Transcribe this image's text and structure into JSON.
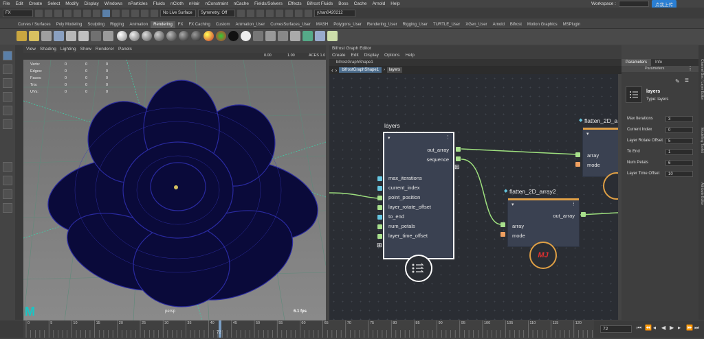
{
  "menubar": {
    "items": [
      "File",
      "Edit",
      "Create",
      "Select",
      "Modify",
      "Display",
      "Windows",
      "nParticles",
      "Fluids",
      "nCloth",
      "nHair",
      "nConstraint",
      "nCache",
      "Fields/Solvers",
      "Effects",
      "Bifrost Fluids",
      "Boss",
      "Cache",
      "Arnold",
      "Help"
    ],
    "workspace_label": "Workspace :",
    "upload_label": "点我上传"
  },
  "statusline": {
    "mode": "FX",
    "live_surface": "No Live Surface",
    "symmetry": "Symmetry: Off",
    "user": "y.han0420212"
  },
  "shelf": {
    "tabs": [
      "Curves / Surfaces",
      "Poly Modeling",
      "Sculpting",
      "Rigging",
      "Animation",
      "Rendering",
      "FX",
      "FX Caching",
      "Custom",
      "Animation_User",
      "CurvesSurfaces_User",
      "MASH",
      "Polygons_User",
      "Rendering_User",
      "Rigging_User",
      "TURTLE_User",
      "XGen_User",
      "Arnold",
      "Bifrost",
      "Motion Graphics",
      "MSPlugin"
    ],
    "active_tab": "Rendering"
  },
  "viewport": {
    "menu": [
      "View",
      "Shading",
      "Lighting",
      "Show",
      "Renderer",
      "Panels"
    ],
    "toolbar_values": {
      "val1": "0.00",
      "val2": "1.00",
      "colorspace": "ACES 1.0"
    },
    "hud": {
      "rows": [
        {
          "label": "Verts:",
          "a": "0",
          "b": "0",
          "c": "0"
        },
        {
          "label": "Edges:",
          "a": "0",
          "b": "0",
          "c": "0"
        },
        {
          "label": "Faces:",
          "a": "0",
          "b": "0",
          "c": "0"
        },
        {
          "label": "Tris:",
          "a": "0",
          "b": "0",
          "c": "0"
        },
        {
          "label": "UVs:",
          "a": "0",
          "b": "0",
          "c": "0"
        }
      ]
    },
    "camera": "persp",
    "fps": "6.1 fps"
  },
  "graph_editor": {
    "title": "Bifrost Graph Editor",
    "menu": [
      "Create",
      "Edit",
      "Display",
      "Options",
      "Help"
    ],
    "tab": "bifrostGraphShape1",
    "breadcrumb": [
      "bifrostGraphShape1",
      "layers"
    ],
    "nodes": {
      "layers": {
        "title": "layers",
        "outputs": [
          "out_array",
          "sequence"
        ],
        "inputs": [
          "max_iterations",
          "current_index",
          "point_position",
          "layer_rotate_offset",
          "to_end",
          "num_petals",
          "layer_time_offset"
        ]
      },
      "flatten1": {
        "title": "flatten_2D_a",
        "inputs": [
          "array",
          "mode"
        ]
      },
      "flatten2": {
        "title": "flatten_2D_array2",
        "outputs": [
          "out_array"
        ],
        "inputs": [
          "array",
          "mode"
        ],
        "badge": "MJ"
      }
    }
  },
  "parameters": {
    "tabs": [
      "Parameters",
      "Info"
    ],
    "section": "Parameters",
    "node_name": "layers",
    "node_type": "Type: layers",
    "fields": [
      {
        "label": "Max Iterations",
        "value": "3"
      },
      {
        "label": "Current Index",
        "value": "0"
      },
      {
        "label": "Layer Rotate Offset",
        "value": "5"
      },
      {
        "label": "To End",
        "value": "1"
      },
      {
        "label": "Num Petals",
        "value": "6"
      },
      {
        "label": "Layer Time Offset",
        "value": "10"
      }
    ]
  },
  "right_strip": [
    "Channel Box / Layer Editor",
    "Modelling Toolkit",
    "Attribute Editor"
  ],
  "timeline": {
    "ticks": [
      "0",
      "5",
      "10",
      "15",
      "20",
      "25",
      "30",
      "35",
      "40",
      "45",
      "50",
      "55",
      "60",
      "65",
      "70",
      "75",
      "80",
      "85",
      "90",
      "95",
      "100",
      "105",
      "110",
      "115",
      "120"
    ],
    "current_frame_marker": "72",
    "current_frame": "72"
  },
  "colors": {
    "port_green": "#a8e08c",
    "port_orange": "#f0a060",
    "port_cyan": "#66c6e0",
    "node_header": "#e0a045",
    "wire": "#9ee07e",
    "flower": "#0a0a3a",
    "flower_wire": "#2a2aa0"
  }
}
